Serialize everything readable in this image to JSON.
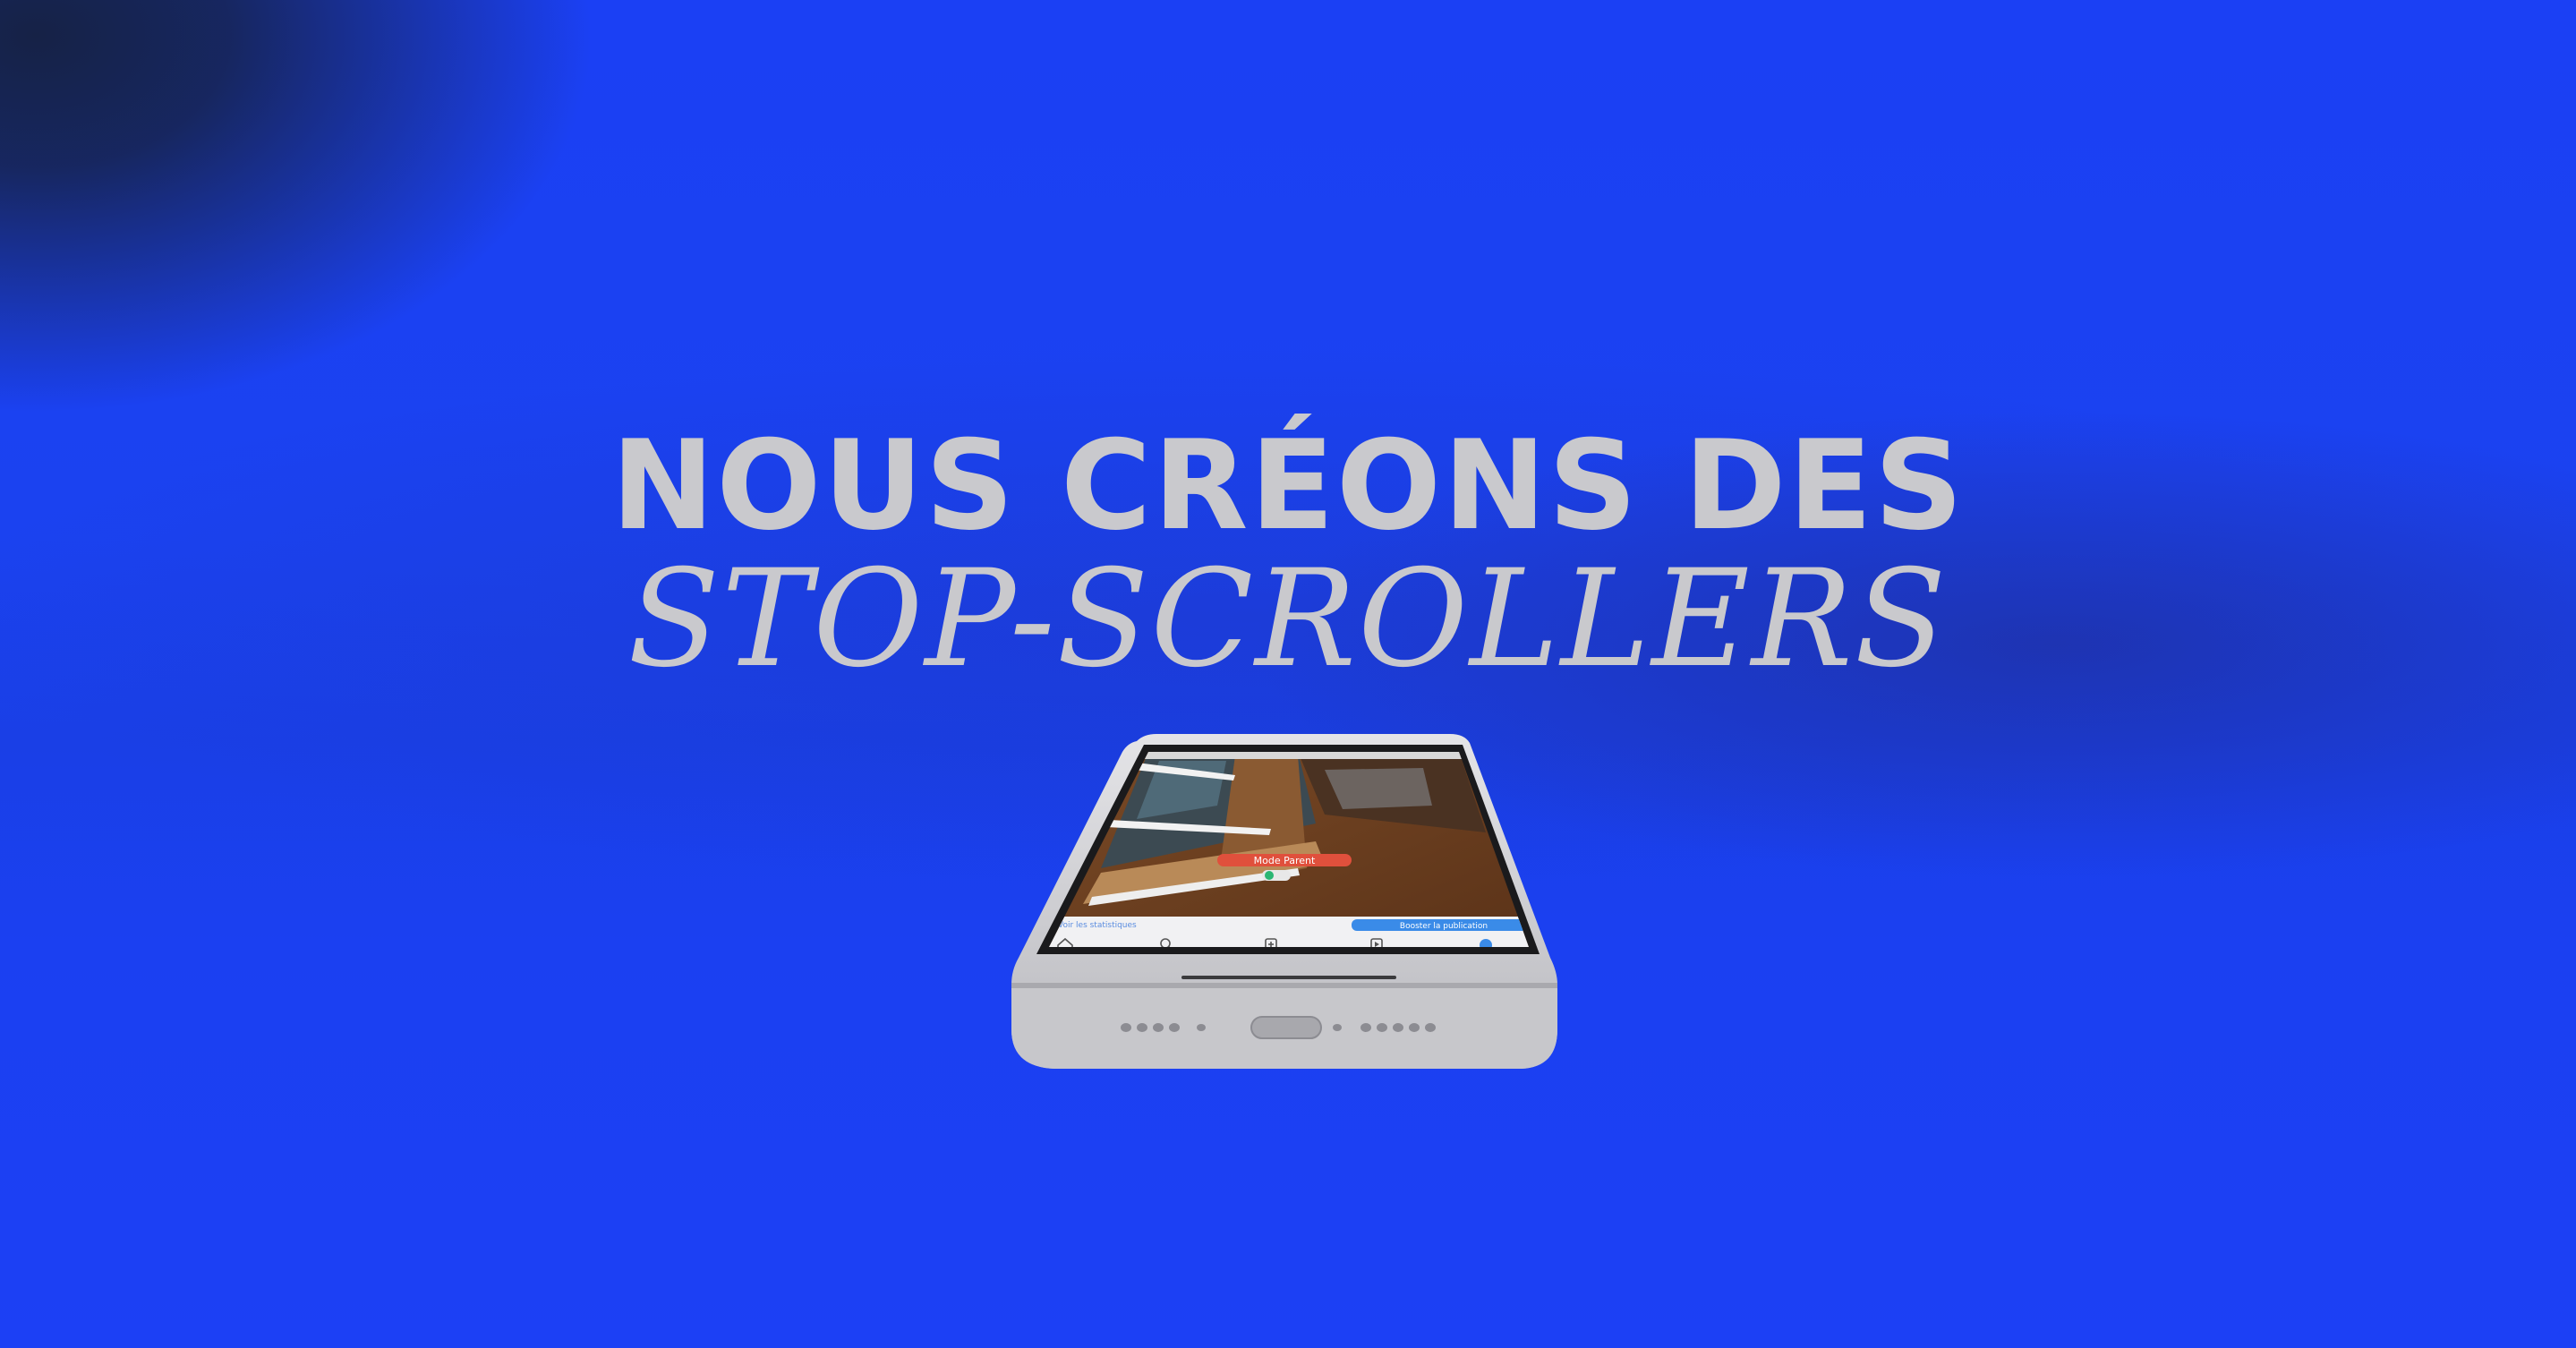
{
  "hero": {
    "line1": "NOUS CRÉONS DES",
    "line2": "STOP-SCROLLERS"
  },
  "phone_screen": {
    "badge_label": "Mode Parent",
    "left_caption": "Voir les statistiques",
    "promote_button_label": "Booster la publication",
    "nav_icons": [
      "home-icon",
      "search-icon",
      "add-icon",
      "reels-icon",
      "profile-icon"
    ]
  },
  "colors": {
    "background": "#1b40f2",
    "corner_shadow": "#162246",
    "headline": "#c9c9cd",
    "phone_body": "#d6d6d9",
    "badge": "#e0503c",
    "promote_button": "#3a8be8"
  }
}
